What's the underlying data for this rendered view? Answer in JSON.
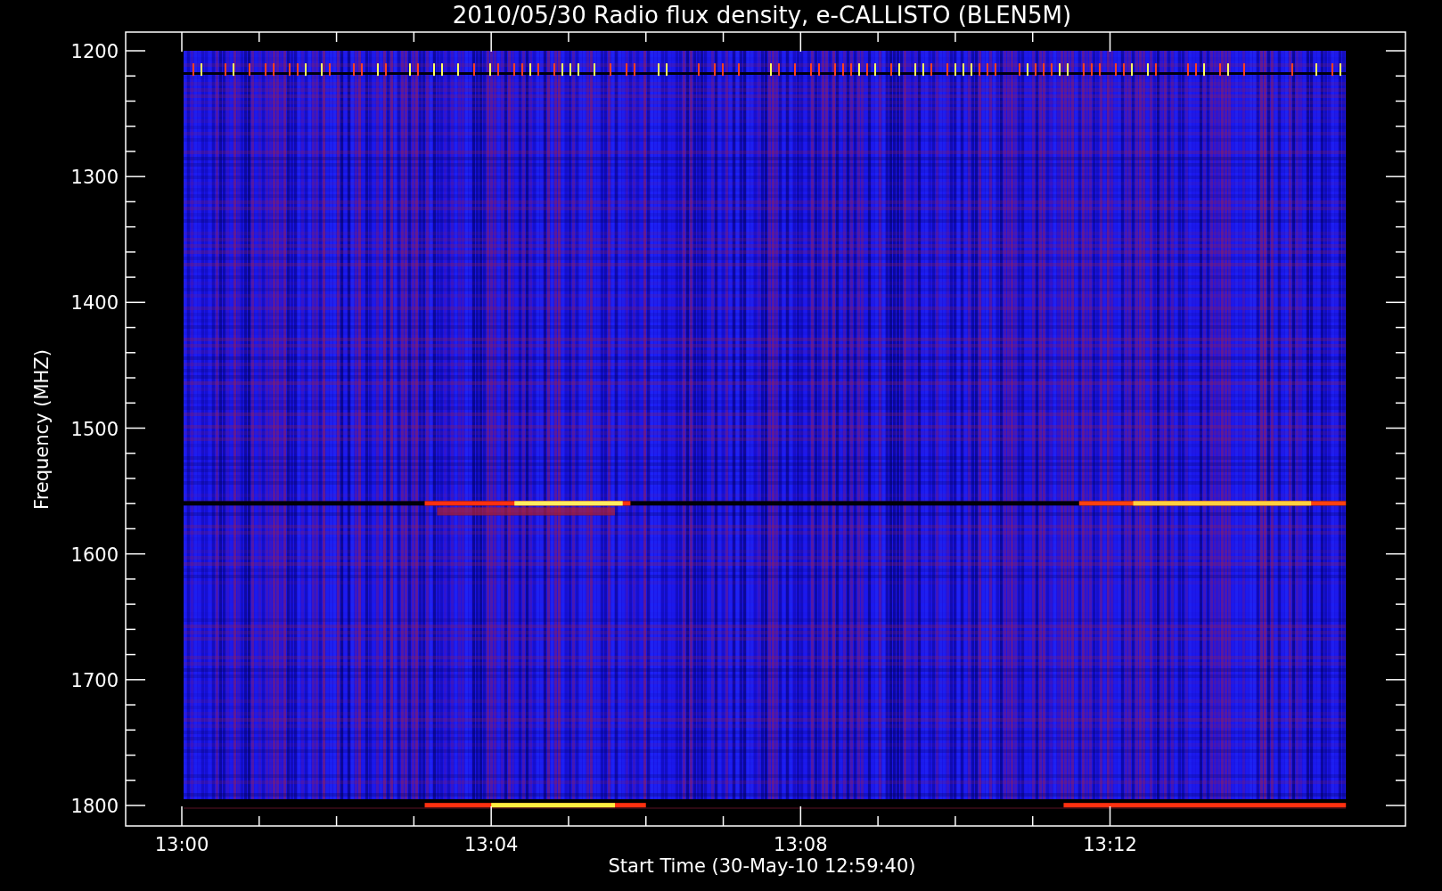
{
  "plot": {
    "title": "2010/05/30  Radio flux density, e-CALLISTO (BLEN5M)",
    "y_axis": {
      "label": "Frequency (MHZ)",
      "ticks": [
        "1200",
        "1300",
        "1400",
        "1500",
        "1600",
        "1700",
        "1800"
      ]
    },
    "x_axis": {
      "label": "Start Time (30-May-10 12:59:40)",
      "ticks": [
        "13:00",
        "13:04",
        "13:08",
        "13:12"
      ]
    }
  }
}
